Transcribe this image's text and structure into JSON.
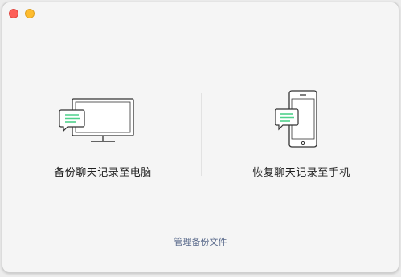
{
  "window": {
    "controls": [
      "close",
      "minimize"
    ]
  },
  "options": {
    "backup": {
      "label": "备份聊天记录至电脑",
      "icon": "monitor-chat-icon"
    },
    "restore": {
      "label": "恢复聊天记录至手机",
      "icon": "phone-chat-icon"
    }
  },
  "footer": {
    "manage_link": "管理备份文件"
  },
  "colors": {
    "accent_green": "#4fd18b",
    "link": "#5b6b8c",
    "close": "#fd5e57",
    "minimize": "#febc2e"
  }
}
